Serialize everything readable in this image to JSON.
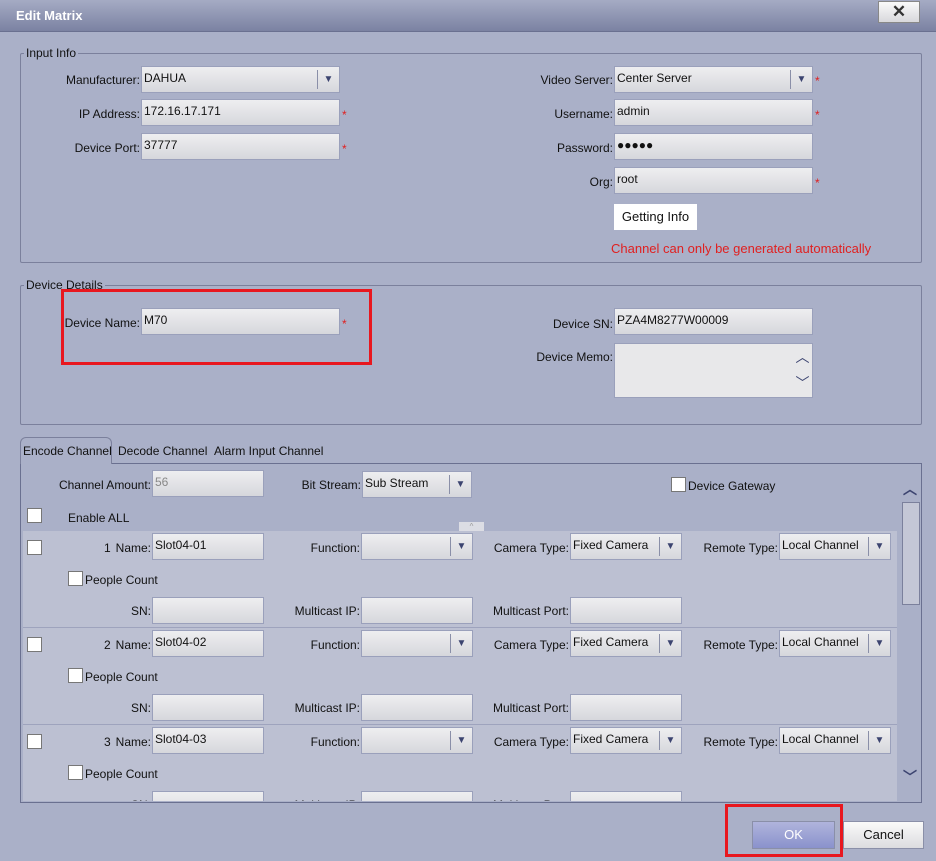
{
  "window": {
    "title": "Edit Matrix",
    "close_icon": "close-icon"
  },
  "input_info": {
    "legend": "Input Info",
    "manufacturer_label": "Manufacturer:",
    "manufacturer": "DAHUA",
    "ip_label": "IP Address:",
    "ip": "172.16.17.171",
    "port_label": "Device Port:",
    "port": "37777",
    "video_server_label": "Video Server:",
    "video_server": "Center Server",
    "username_label": "Username:",
    "username": "admin",
    "password_label": "Password:",
    "password": "●●●●●",
    "org_label": "Org:",
    "org": "root",
    "getting_info": "Getting Info",
    "warning": "Channel can only be generated automatically",
    "required": "*"
  },
  "device_details": {
    "legend": "Device Details",
    "name_label": "Device Name:",
    "name": "M70",
    "sn_label": "Device SN:",
    "sn": "PZA4M8277W00009",
    "memo_label": "Device Memo:",
    "memo": ""
  },
  "tabs": [
    "Encode Channel",
    "Decode Channel",
    "Alarm Input Channel"
  ],
  "encode": {
    "amount_label": "Channel Amount:",
    "amount": "56",
    "bitstream_label": "Bit Stream:",
    "bitstream": "Sub Stream",
    "gateway_label": "Device Gateway",
    "enable_all": "Enable ALL",
    "labels": {
      "name": "Name:",
      "function": "Function:",
      "camera_type": "Camera Type:",
      "remote_type": "Remote Type:",
      "people_count": "People Count",
      "sn": "SN:",
      "multicast_ip": "Multicast IP:",
      "multicast_port": "Multicast Port:"
    },
    "channels": [
      {
        "num": "1",
        "name": "Slot04-01",
        "function": "",
        "camera_type": "Fixed Camera",
        "remote_type": "Local Channel",
        "sn": "",
        "multicast_ip": "",
        "multicast_port": ""
      },
      {
        "num": "2",
        "name": "Slot04-02",
        "function": "",
        "camera_type": "Fixed Camera",
        "remote_type": "Local Channel",
        "sn": "",
        "multicast_ip": "",
        "multicast_port": ""
      },
      {
        "num": "3",
        "name": "Slot04-03",
        "function": "",
        "camera_type": "Fixed Camera",
        "remote_type": "Local Channel",
        "sn": "",
        "multicast_ip": "",
        "multicast_port": ""
      }
    ]
  },
  "footer": {
    "ok": "OK",
    "cancel": "Cancel"
  },
  "colors": {
    "highlight": "#e8171f",
    "warning": "#e02020"
  }
}
